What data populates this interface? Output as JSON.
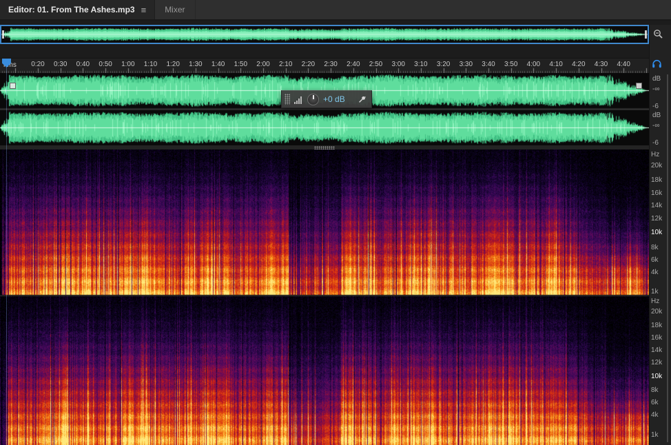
{
  "tabs": {
    "editor": {
      "label": "Editor: 01. From The Ashes.mp3"
    },
    "mixer": {
      "label": "Mixer"
    }
  },
  "icons": {
    "panel_menu": "≡"
  },
  "ruler": {
    "unit": "hms",
    "times": [
      "0:20",
      "0:30",
      "0:40",
      "0:50",
      "1:00",
      "1:10",
      "1:20",
      "1:30",
      "1:40",
      "1:50",
      "2:00",
      "2:10",
      "2:20",
      "2:30",
      "2:40",
      "2:50",
      "3:00",
      "3:10",
      "3:20",
      "3:30",
      "3:40",
      "3:50",
      "4:00",
      "4:10",
      "4:20",
      "4:30",
      "4:40"
    ]
  },
  "hud": {
    "gain": "+0 dB"
  },
  "scales": {
    "db": [
      "dB",
      "-∞",
      "-6"
    ],
    "freq": [
      "Hz",
      "20k",
      "18k",
      "16k",
      "14k",
      "12k",
      "10k",
      "8k",
      "6k",
      "4k",
      "1k"
    ],
    "freq_highlight": "10k"
  },
  "colors": {
    "waveform_green": "#5fdd9d",
    "navigator_border_blue": "#4088cc",
    "hud_value_blue": "#7fc4e8",
    "monitor_blue": "#2f8ceb"
  }
}
